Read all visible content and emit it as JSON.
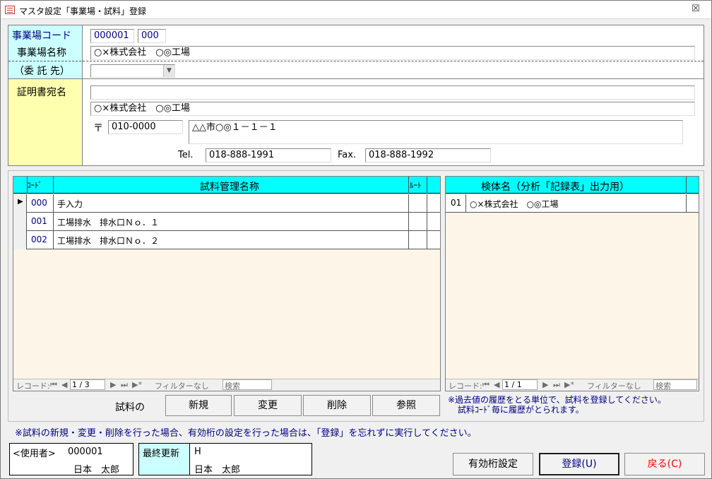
{
  "window": {
    "title": "マスタ設定「事業場・試料」登録",
    "close": "☒"
  },
  "plant": {
    "code_label": "事業場コード",
    "name_label": "事業場名称",
    "entrust_label": "（委 託 先）",
    "code1": "000001",
    "code2": "000",
    "name": "○×株式会社　○◎工場",
    "entrust_value": ""
  },
  "certificate": {
    "label": "証明書宛名",
    "line1": "",
    "line2": "○×株式会社　○◎工場",
    "postal_mark": "〒",
    "postal_code": "010-0000",
    "address": "△△市○◎１－１－１",
    "tel_label": "Tel.",
    "tel": "018-888-1991",
    "fax_label": "Fax.",
    "fax": "018-888-1992"
  },
  "sample_grid": {
    "headers": [
      "ｺｰﾄﾞ",
      "試料管理名称",
      "ﾙｰﾄ"
    ],
    "rows": [
      {
        "selector": "▶",
        "code": "000",
        "name": "手入力"
      },
      {
        "selector": "",
        "code": "001",
        "name": "工場排水　排水口Ｎｏ．１"
      },
      {
        "selector": "",
        "code": "002",
        "name": "工場排水　排水口Ｎｏ．２"
      }
    ],
    "nav": {
      "record_label": "レコード:",
      "first": "⏮",
      "prev": "◀",
      "position": "1 / 3",
      "next": "▶",
      "last": "⏭",
      "new": "▶*",
      "filter": "フィルターなし",
      "search": "検索"
    }
  },
  "specimen_grid": {
    "header": "検体名（分析「記録表」出力用）",
    "rows": [
      {
        "code": "01",
        "name": "○×株式会社　○◎工場"
      }
    ],
    "nav": {
      "record_label": "レコード:",
      "first": "⏮",
      "prev": "◀",
      "position": "1 / 1",
      "next": "▶",
      "last": "⏭",
      "new": "▶*",
      "filter": "フィルターなし",
      "search": "検索"
    }
  },
  "actions": {
    "sample_label": "試料の",
    "new": "新規",
    "change": "変更",
    "delete": "削除",
    "reference": "参照",
    "note_line1": "※過去値の履歴をとる単位で、試料を登録してください。",
    "note_line2": "試料ｺｰﾄﾞ毎に履歴がとられます。"
  },
  "warning": "※試料の新規・変更・削除を行った場合、有効桁の設定を行った場合は、「登録」を忘れずに実行してください。",
  "user": {
    "label": "<使用者>",
    "id": "000001",
    "name": "日本　太郎"
  },
  "last_update": {
    "label": "最終更新",
    "flag": "H",
    "name": "日本　太郎"
  },
  "buttons": {
    "digits": "有効桁設定",
    "register": "登録(U)",
    "back": "戻る(C)"
  },
  "colors": {
    "label_cyan": "#ccffff",
    "header_cyan": "#00ffff",
    "cert_yellow": "#ffffb0",
    "grid_bg": "#fdf6e8",
    "back_red": "#ff0000",
    "code_navy": "#000080"
  }
}
